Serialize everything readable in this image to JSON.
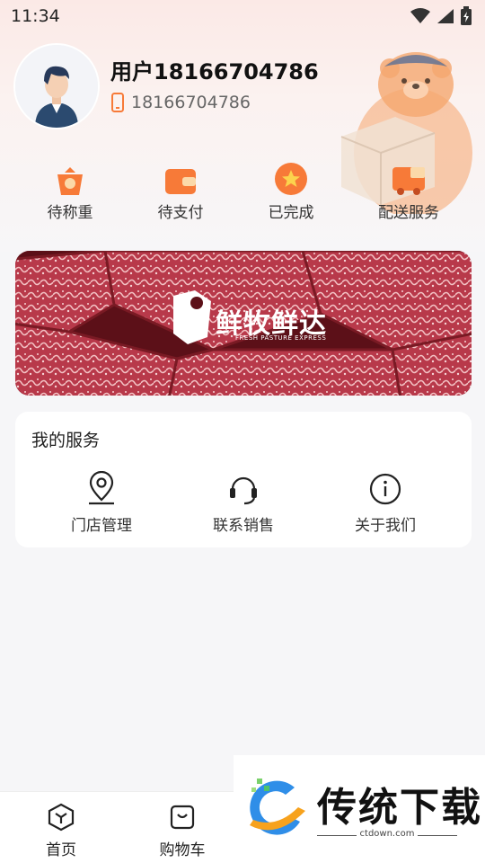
{
  "status_bar": {
    "time": "11:34"
  },
  "profile": {
    "name": "用户18166704786",
    "phone": "18166704786"
  },
  "orders": [
    {
      "label": "待称重",
      "icon": "scale-icon"
    },
    {
      "label": "待支付",
      "icon": "wallet-icon"
    },
    {
      "label": "已完成",
      "icon": "star-badge-icon"
    },
    {
      "label": "配送服务",
      "icon": "delivery-truck-icon"
    }
  ],
  "banner": {
    "brand": "鲜牧鲜达",
    "tagline": "FRESH PASTURE EXPRESS"
  },
  "services": {
    "title": "我的服务",
    "items": [
      {
        "label": "门店管理",
        "icon": "location-pin-icon"
      },
      {
        "label": "联系销售",
        "icon": "headset-icon"
      },
      {
        "label": "关于我们",
        "icon": "info-icon"
      }
    ]
  },
  "bottom_nav": [
    {
      "label": "首页",
      "icon": "home-cube-icon"
    },
    {
      "label": "购物车",
      "icon": "shopping-bag-icon"
    }
  ],
  "watermark": {
    "title": "传统下载",
    "url": "ctdown.com"
  },
  "colors": {
    "accent": "#f77a38",
    "card": "#ffffff",
    "background": "#f6f6f8"
  }
}
